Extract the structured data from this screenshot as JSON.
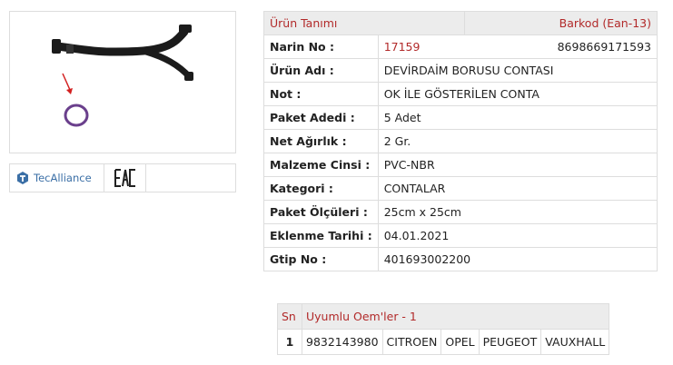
{
  "product_image": {
    "icon": "hose-with-o-ring-image"
  },
  "logos": {
    "tecalliance_label": "TecAlliance",
    "eac_label": "EAC"
  },
  "product_table": {
    "header_left": "Ürün Tanımı",
    "header_right": "Barkod (Ean-13)",
    "rows": [
      {
        "label": "Narin No :",
        "value": "17159",
        "extra": "8698669171593"
      },
      {
        "label": "Ürün Adı :",
        "value": "DEVİRDAİM BORUSU CONTASI"
      },
      {
        "label": "Not :",
        "value": "OK İLE GÖSTERİLEN CONTA"
      },
      {
        "label": "Paket Adedi :",
        "value": "5 Adet"
      },
      {
        "label": "Net Ağırlık :",
        "value": "2 Gr."
      },
      {
        "label": "Malzeme Cinsi :",
        "value": "PVC-NBR"
      },
      {
        "label": "Kategori :",
        "value": "CONTALAR"
      },
      {
        "label": "Paket Ölçüleri :",
        "value": "25cm x 25cm"
      },
      {
        "label": "Eklenme Tarihi :",
        "value": "04.01.2021"
      },
      {
        "label": "Gtip No :",
        "value": "401693002200"
      }
    ]
  },
  "oem_table": {
    "header_sn": "Sn",
    "header_title": "Uyumlu Oem'ler - 1",
    "rows": [
      {
        "sn": "1",
        "oem": "9832143980",
        "brands": [
          "CITROEN",
          "OPEL",
          "PEUGEOT",
          "VAUXHALL"
        ]
      }
    ]
  },
  "colors": {
    "accent": "#b22a2a",
    "header_bg": "#ececec",
    "border": "#dddddd"
  }
}
